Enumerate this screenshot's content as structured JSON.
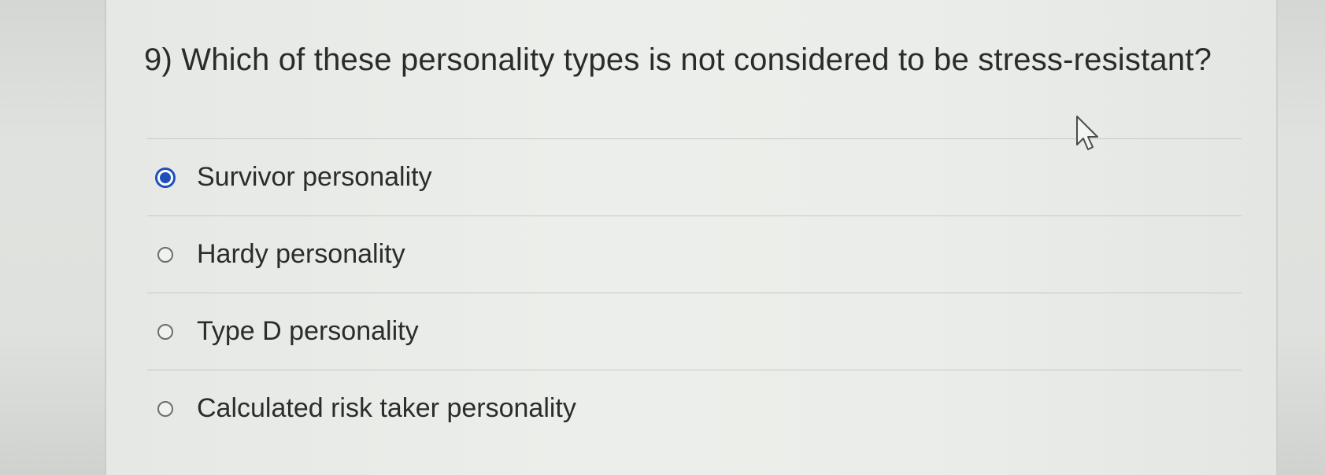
{
  "question": {
    "text": "9) Which of these personality types is not considered to be stress-resistant?"
  },
  "options": [
    {
      "label": "Survivor personality",
      "selected": true
    },
    {
      "label": "Hardy personality",
      "selected": false
    },
    {
      "label": "Type D personality",
      "selected": false
    },
    {
      "label": "Calculated risk taker personality",
      "selected": false
    }
  ],
  "colors": {
    "selected_radio": "#1f4fb8",
    "text": "#2b2d2c"
  },
  "icons": {
    "cursor": "arrow-cursor-icon"
  }
}
